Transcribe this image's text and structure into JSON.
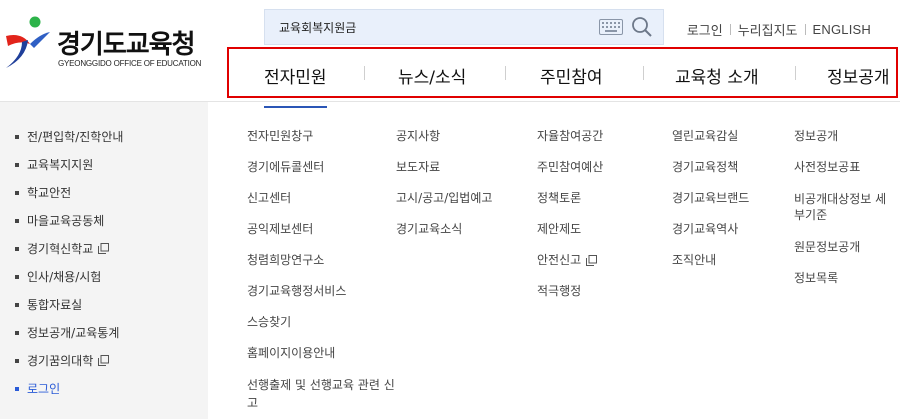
{
  "logo": {
    "title": "경기도교육청",
    "subtitle": "GYEONGGIDO OFFICE OF EDUCATION"
  },
  "search": {
    "value": "교육회복지원금",
    "keyboard_icon": "keyboard-icon",
    "search_icon": "search-icon"
  },
  "util": {
    "login": "로그인",
    "sitemap": "누리집지도",
    "english": "ENGLISH"
  },
  "gnb": {
    "items": [
      "전자민원",
      "뉴스/소식",
      "주민참여",
      "교육청 소개",
      "정보공개"
    ],
    "active": "전자민원"
  },
  "sidebar": {
    "items": [
      "전/편입학/진학안내",
      "교육복지지원",
      "학교안전",
      "마을교육공동체",
      "경기혁신학교",
      "인사/채용/시험",
      "통합자료실",
      "정보공개/교육통계",
      "경기꿈의대학",
      "로그인"
    ]
  },
  "submenu": {
    "col1": [
      "전자민원창구",
      "경기에듀콜센터",
      "신고센터",
      "공익제보센터",
      "청렴희망연구소",
      "경기교육행정서비스",
      "스승찾기",
      "홈페이지이용안내",
      "선행출제 및 선행교육 관련 신고"
    ],
    "col2": [
      "공지사항",
      "보도자료",
      "고시/공고/입법예고",
      "경기교육소식"
    ],
    "col3": [
      "자율참여공간",
      "주민참여예산",
      "정책토론",
      "제안제도",
      "안전신고",
      "적극행정"
    ],
    "col4": [
      "열린교육감실",
      "경기교육정책",
      "경기교육브랜드",
      "경기교육역사",
      "조직안내"
    ],
    "col5": [
      "정보공개",
      "사전정보공표",
      "비공개대상정보 세부기준",
      "원문정보공개",
      "정보목록"
    ]
  },
  "colors": {
    "highlight_border": "#e00000",
    "accent_blue": "#2a5bd7",
    "sidebar_bg": "#f4f4f4",
    "search_bg": "#e9f0fb"
  }
}
